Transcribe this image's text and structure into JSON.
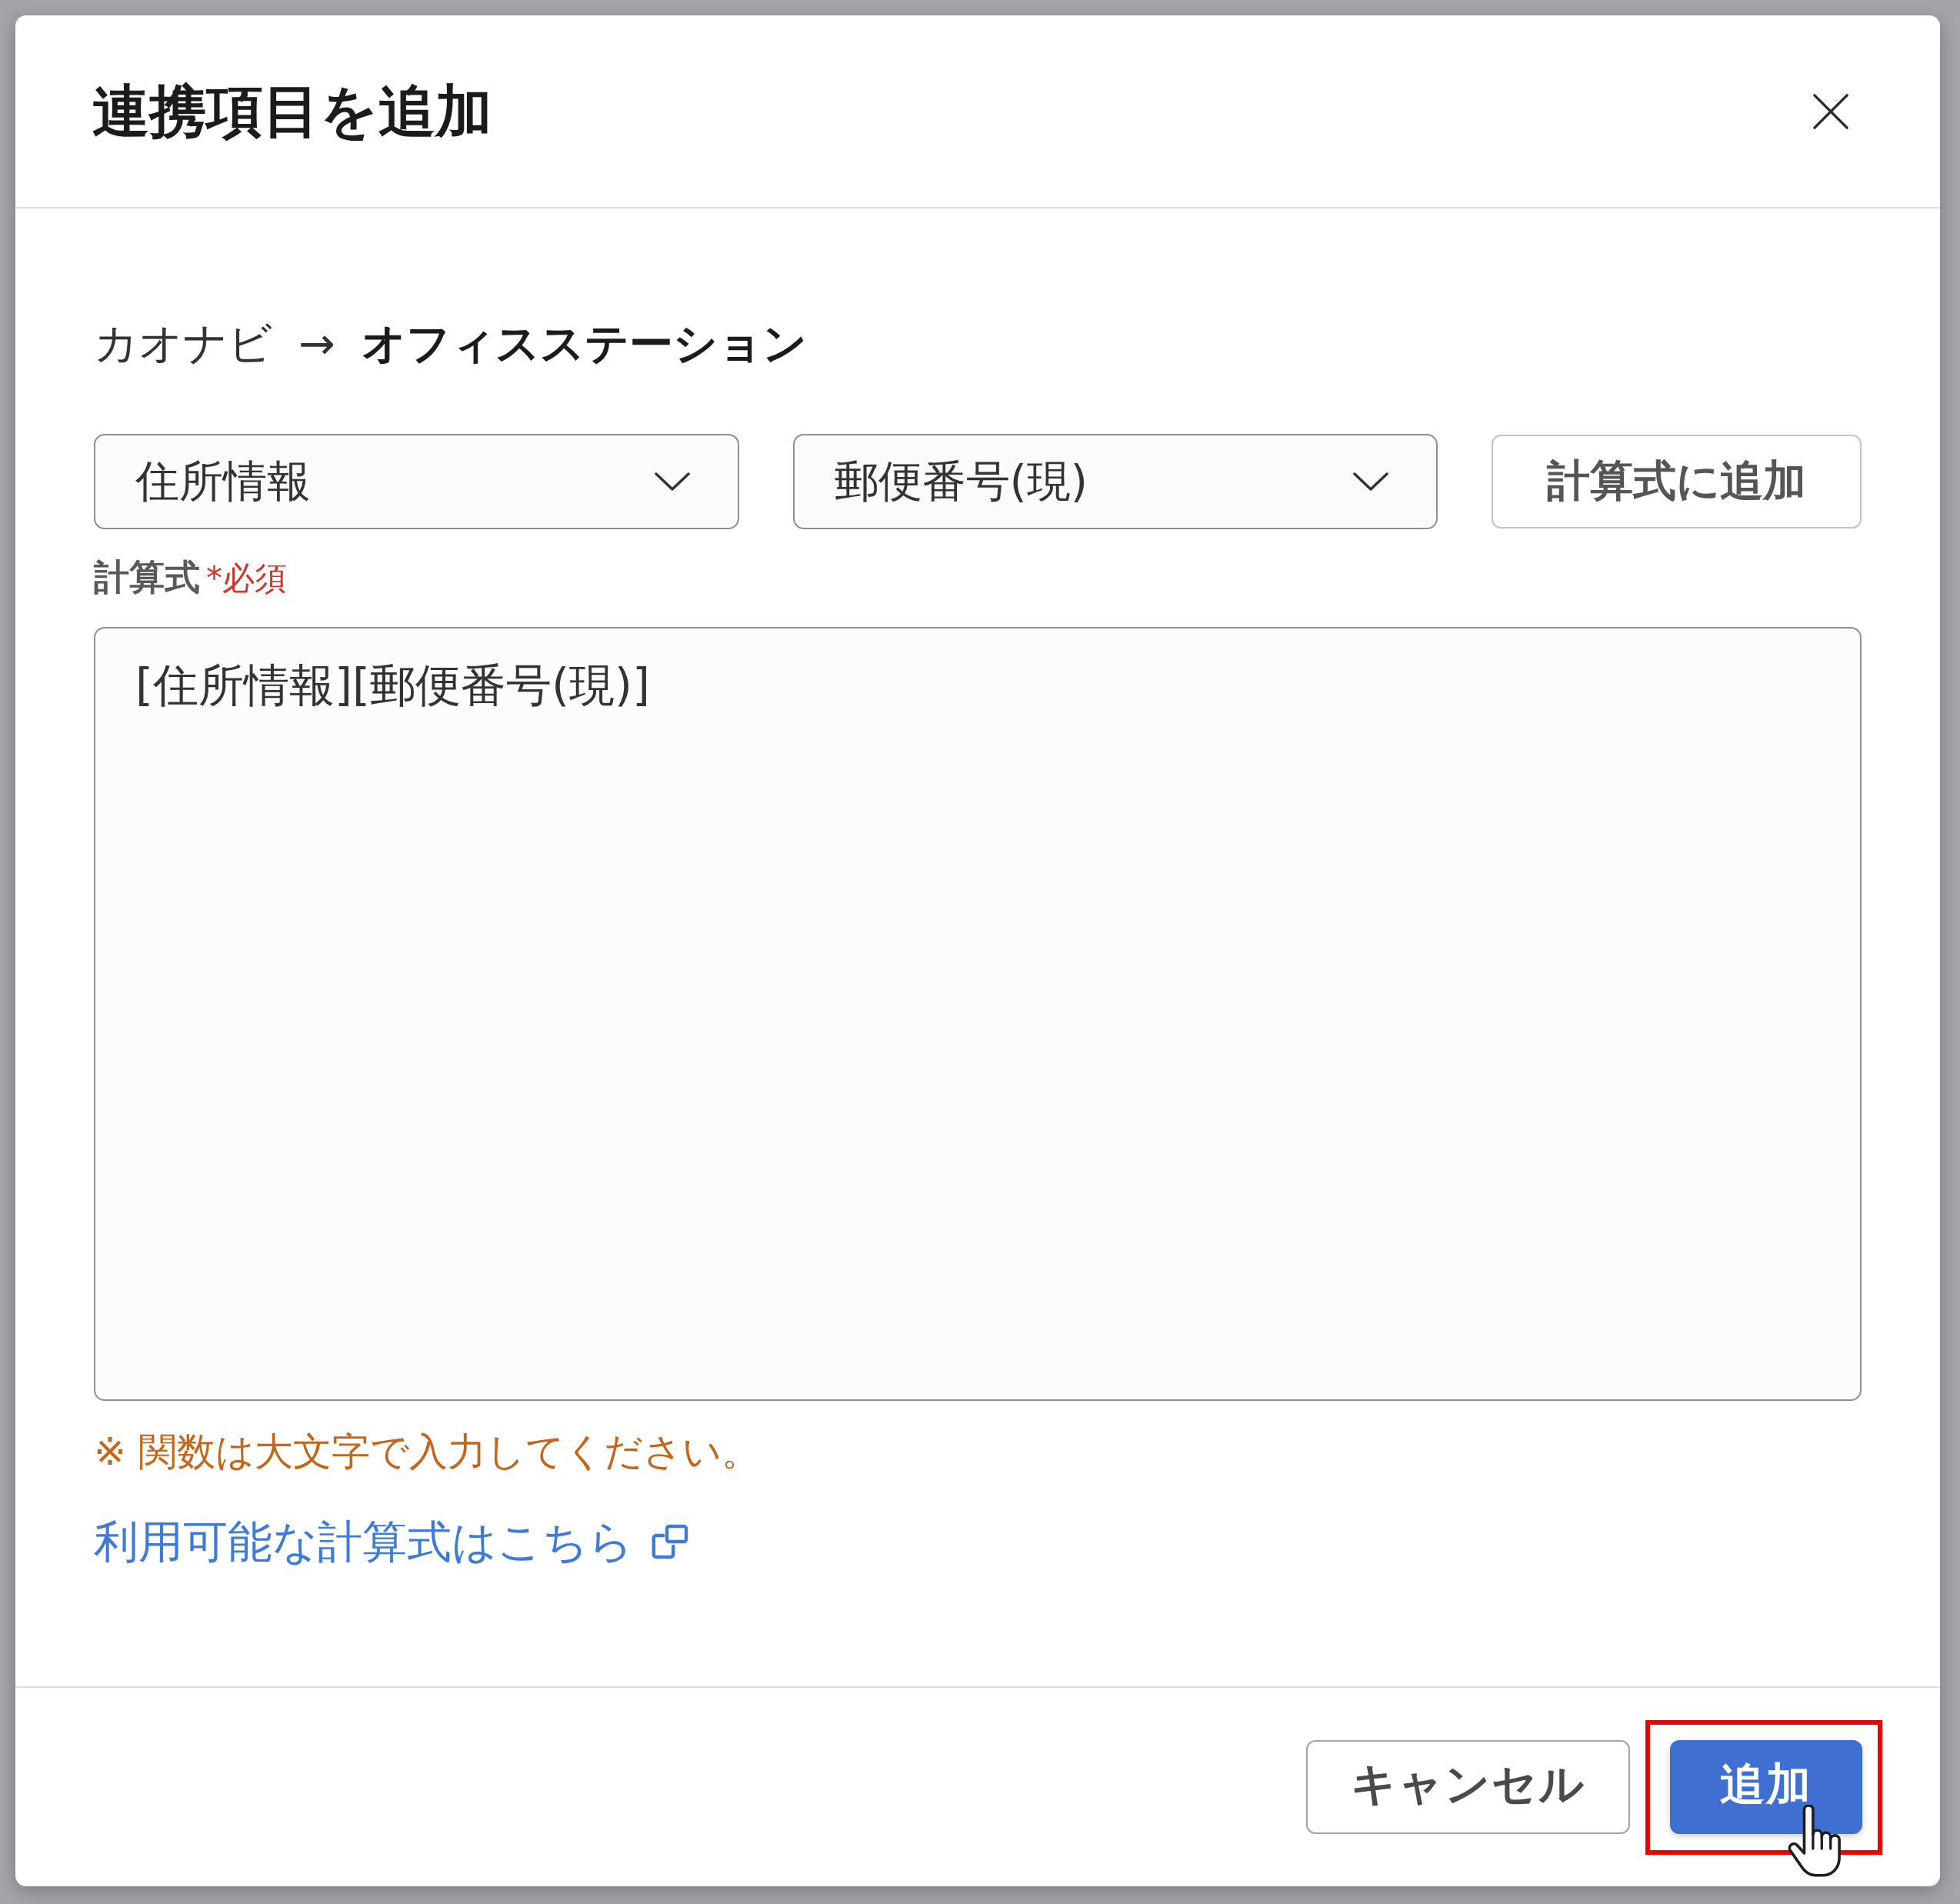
{
  "dialog": {
    "title": "連携項目を追加"
  },
  "mapping": {
    "source": "カオナビ",
    "arrow": "→",
    "target": "オフィスステーション"
  },
  "pickers": [
    {
      "value": "住所情報"
    },
    {
      "value": "郵便番号(現)"
    }
  ],
  "insert_button": {
    "label": "計算式に追加"
  },
  "formula": {
    "label": "計算式",
    "required_mark": "*必須",
    "value": "[住所情報][郵便番号(現)]"
  },
  "note": "※ 関数は大文字で入力してください。",
  "help_link": {
    "label": "利用可能な計算式はこちら"
  },
  "buttons": [
    {
      "label": "キャンセル",
      "kind": "secondary",
      "highlighted": false
    },
    {
      "label": "追加",
      "kind": "primary",
      "highlighted": true
    }
  ]
}
